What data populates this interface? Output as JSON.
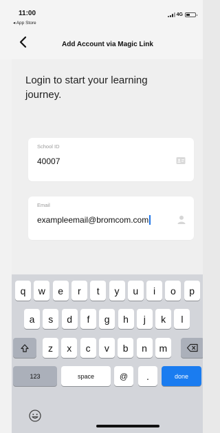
{
  "status_bar": {
    "time": "11:00",
    "back_app": "◂ App Store",
    "network": "4G"
  },
  "nav": {
    "title": "Add Account via Magic Link"
  },
  "content": {
    "heading": "Login to start your learning journey."
  },
  "school_id": {
    "label": "School ID",
    "value": "40007"
  },
  "email": {
    "label": "Email",
    "value": "exampleemail@bromcom.com"
  },
  "keyboard": {
    "row1": [
      "q",
      "w",
      "e",
      "r",
      "t",
      "y",
      "u",
      "i",
      "o",
      "p"
    ],
    "row2": [
      "a",
      "s",
      "d",
      "f",
      "g",
      "h",
      "j",
      "k",
      "l"
    ],
    "row3": [
      "z",
      "x",
      "c",
      "v",
      "b",
      "n",
      "m"
    ],
    "numbers": "123",
    "space": "space",
    "at": "@",
    "dot": ".",
    "done": "done"
  },
  "colors": {
    "accent": "#1a7cf0",
    "keyboard_bg": "#d3d5da"
  }
}
